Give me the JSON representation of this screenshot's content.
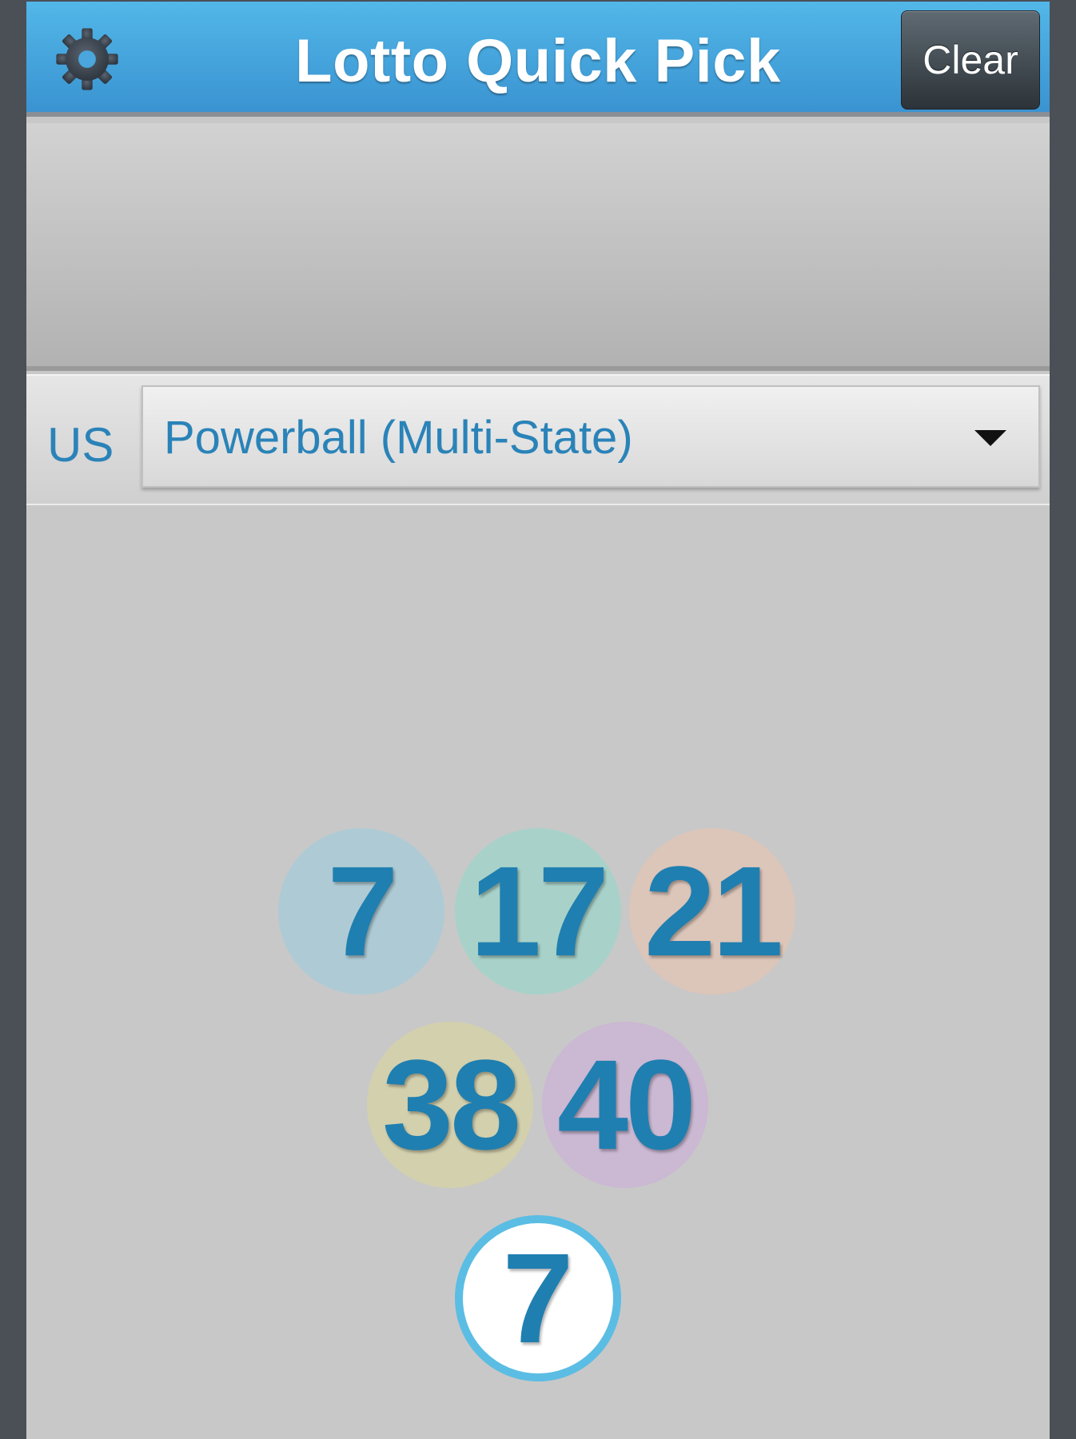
{
  "header": {
    "title": "Lotto Quick Pick",
    "clear_label": "Clear",
    "settings_icon": "gear-icon"
  },
  "selector": {
    "region": "US",
    "selected_lottery": "Powerball (Multi-State)",
    "dropdown_icon": "triangle-down-icon"
  },
  "numbers": {
    "main": [
      {
        "value": "7",
        "color": "#aecbd5"
      },
      {
        "value": "17",
        "color": "#a8d2c9"
      },
      {
        "value": "21",
        "color": "#dcc5b9"
      },
      {
        "value": "38",
        "color": "#d3d0ae"
      },
      {
        "value": "40",
        "color": "#cbb8d3"
      }
    ],
    "power": {
      "value": "7",
      "border_color": "#5bbde3"
    }
  },
  "colors": {
    "header_top": "#52b7e8",
    "header_bottom": "#3a93d1",
    "accent_text": "#2a83b8",
    "number_text": "#1f7fb0",
    "background": "#c8c8c8"
  }
}
